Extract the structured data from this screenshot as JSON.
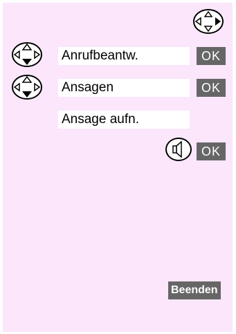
{
  "menu": {
    "item1": "Anrufbeantw.",
    "item2": "Ansagen",
    "item3": "Ansage aufn."
  },
  "keys": {
    "ok1": "OK",
    "ok2": "OK",
    "ok3": "OK",
    "end": "Beenden"
  },
  "icons": {
    "nav_right": "nav-key-right-icon",
    "nav_updown": "nav-key-updown-icon",
    "speaker": "speaker-icon"
  },
  "colors": {
    "background": "#fbe6fb",
    "field": "#ffffff",
    "softkey": "#666666",
    "softkey_text": "#ffffff"
  }
}
